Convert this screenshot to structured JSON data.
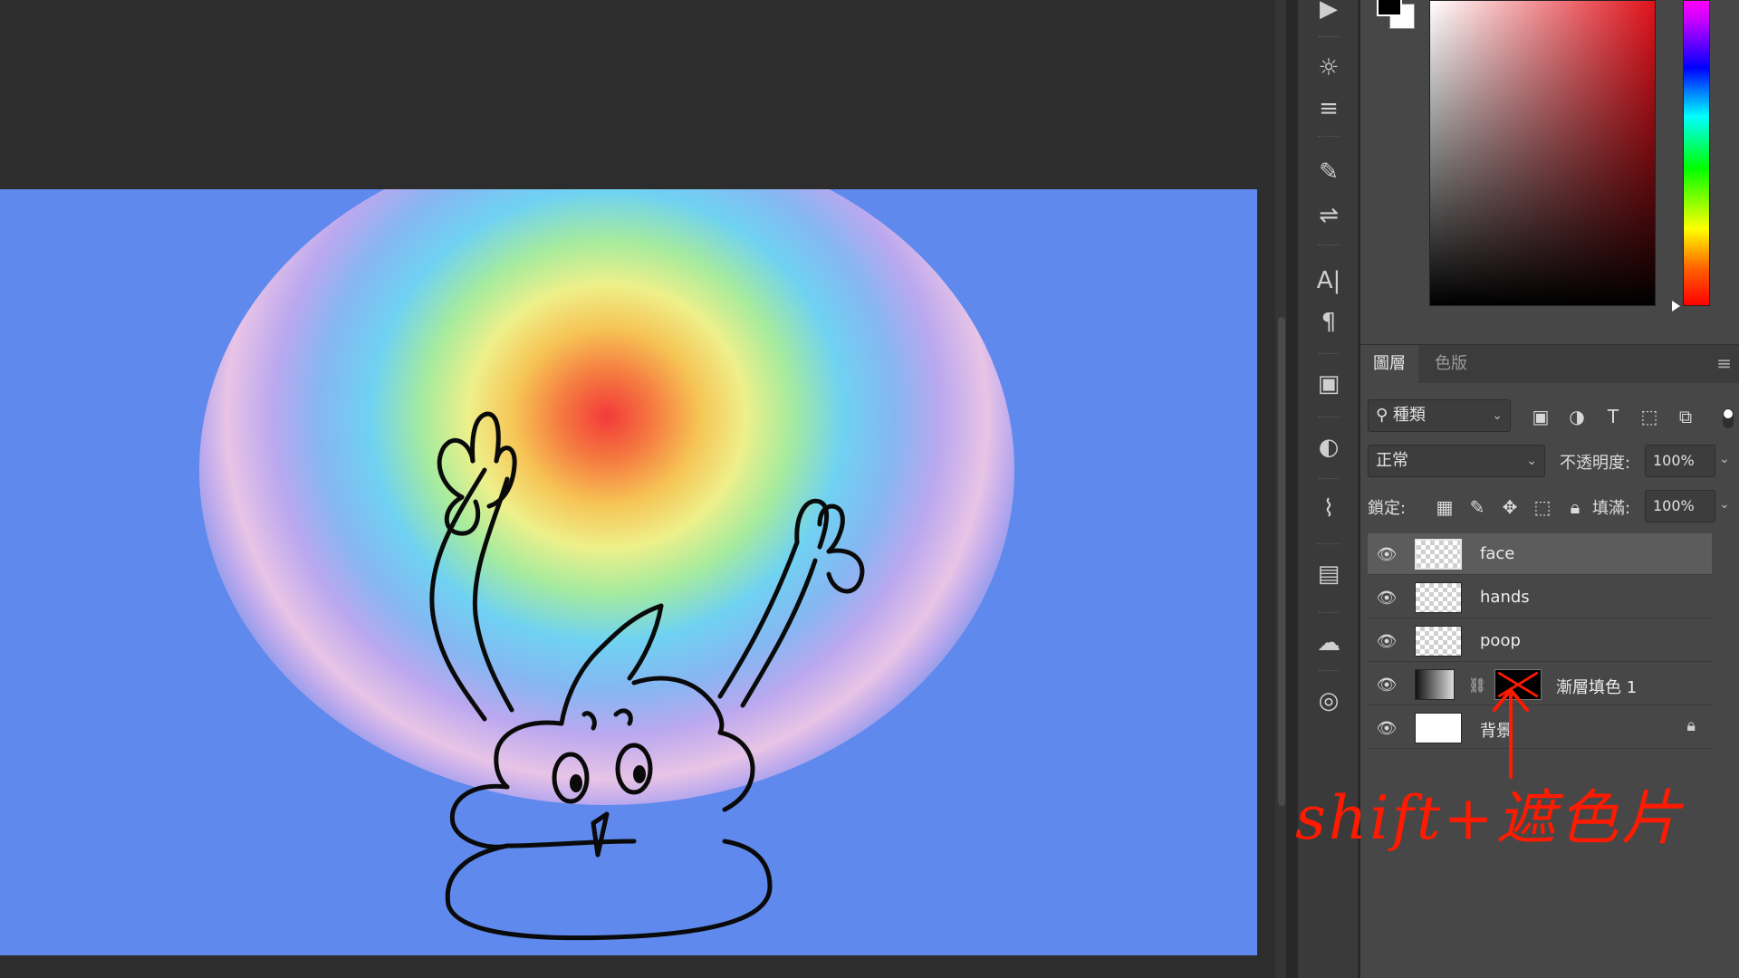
{
  "tools": [
    {
      "icon": "play-icon",
      "glyph": "▶"
    },
    {
      "icon": "gear-sun-icon",
      "glyph": "☼"
    },
    {
      "icon": "histogram-icon",
      "glyph": "≡"
    },
    {
      "icon": "brush-settings-icon",
      "glyph": "✎"
    },
    {
      "icon": "sliders-icon",
      "glyph": "⇌"
    },
    {
      "icon": "character-icon",
      "glyph": "A|"
    },
    {
      "icon": "paragraph-icon",
      "glyph": "¶"
    },
    {
      "icon": "properties-icon",
      "glyph": "▣"
    },
    {
      "icon": "adjustments-icon",
      "glyph": "◐"
    },
    {
      "icon": "paths-icon",
      "glyph": "⌇"
    },
    {
      "icon": "libraries-icon",
      "glyph": "▤"
    },
    {
      "icon": "cloud-icon",
      "glyph": "☁"
    },
    {
      "icon": "color-wheel-icon",
      "glyph": "◎"
    }
  ],
  "colors": {
    "foreground": "#000000",
    "background": "#ffffff",
    "picker_hue": "#e1121b",
    "canvas": "#5f89ec",
    "annotation": "#ff1a00"
  },
  "layers_panel": {
    "tabs": {
      "layers": "圖層",
      "channels": "色版"
    },
    "filter": {
      "kind": "種類",
      "icons": [
        "image-filter-icon",
        "adjustment-filter-icon",
        "type-filter-icon",
        "shape-filter-icon",
        "smart-object-filter-icon"
      ]
    },
    "blend_mode": "正常",
    "opacity_label": "不透明度:",
    "opacity": "100%",
    "lock_label": "鎖定:",
    "fill_label": "填滿:",
    "fill": "100%",
    "layers": [
      {
        "name": "face",
        "selected": true
      },
      {
        "name": "hands"
      },
      {
        "name": "poop"
      },
      {
        "name": "漸層填色 1"
      },
      {
        "name": "背景"
      }
    ]
  },
  "annotation": {
    "text": "shift+遮色片"
  }
}
